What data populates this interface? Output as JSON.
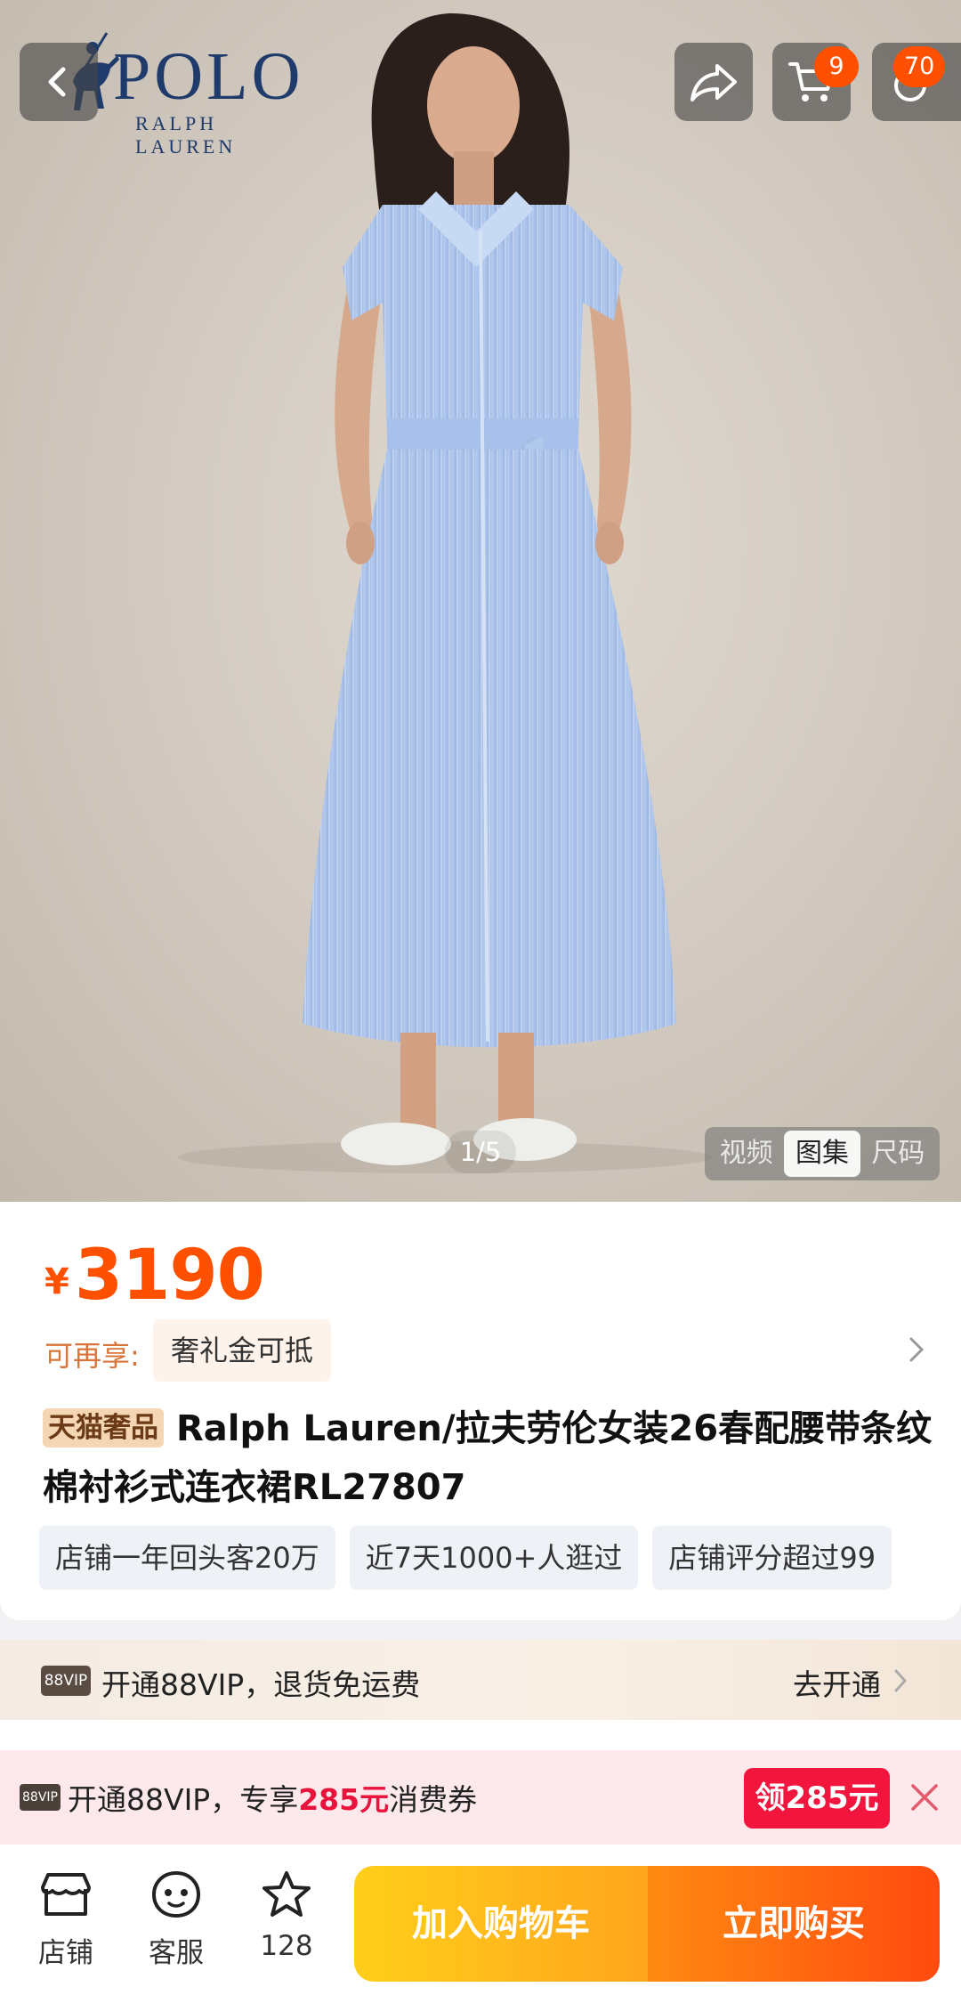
{
  "header": {
    "brand_main": "POLO",
    "brand_sub": "RALPH LAUREN",
    "cart_count": "9",
    "more_count": "70",
    "icons": [
      "back-icon",
      "share-icon",
      "cart-icon",
      "more-icon"
    ]
  },
  "gallery": {
    "counter": "1/5",
    "tabs": [
      "视频",
      "图集",
      "尺码"
    ],
    "active_tab": "图集",
    "colors": {
      "dress": "#a9c4ec",
      "backdrop": "#d4ccc2"
    }
  },
  "product": {
    "currency": "¥",
    "price": "3190",
    "enjoy_label": "可再享:",
    "enjoy_chip": "奢礼金可抵",
    "tag": "天猫奢品",
    "title": "Ralph Lauren/拉夫劳伦女装26春配腰带条纹棉衬衫式连衣裙RL27807",
    "chips": [
      "店铺一年回头客20万",
      "近7天1000+人逛过",
      "店铺评分超过99"
    ]
  },
  "vip": {
    "badge": "88VIP",
    "text": "开通88VIP，退货免运费",
    "action": "去开通"
  },
  "coupon_bar": {
    "badge": "88VIP",
    "text_prefix": "开通88VIP，专享",
    "amount": "285元",
    "text_suffix": "消费券",
    "button": "领285元"
  },
  "bottom_bar": {
    "shop": "店铺",
    "service": "客服",
    "favorites": "128",
    "add_to_cart": "加入购物车",
    "buy_now": "立即购买"
  },
  "colors": {
    "accent": "#ff5000",
    "coupon_red": "#f2153d",
    "brand_navy": "#1f3b6b"
  }
}
